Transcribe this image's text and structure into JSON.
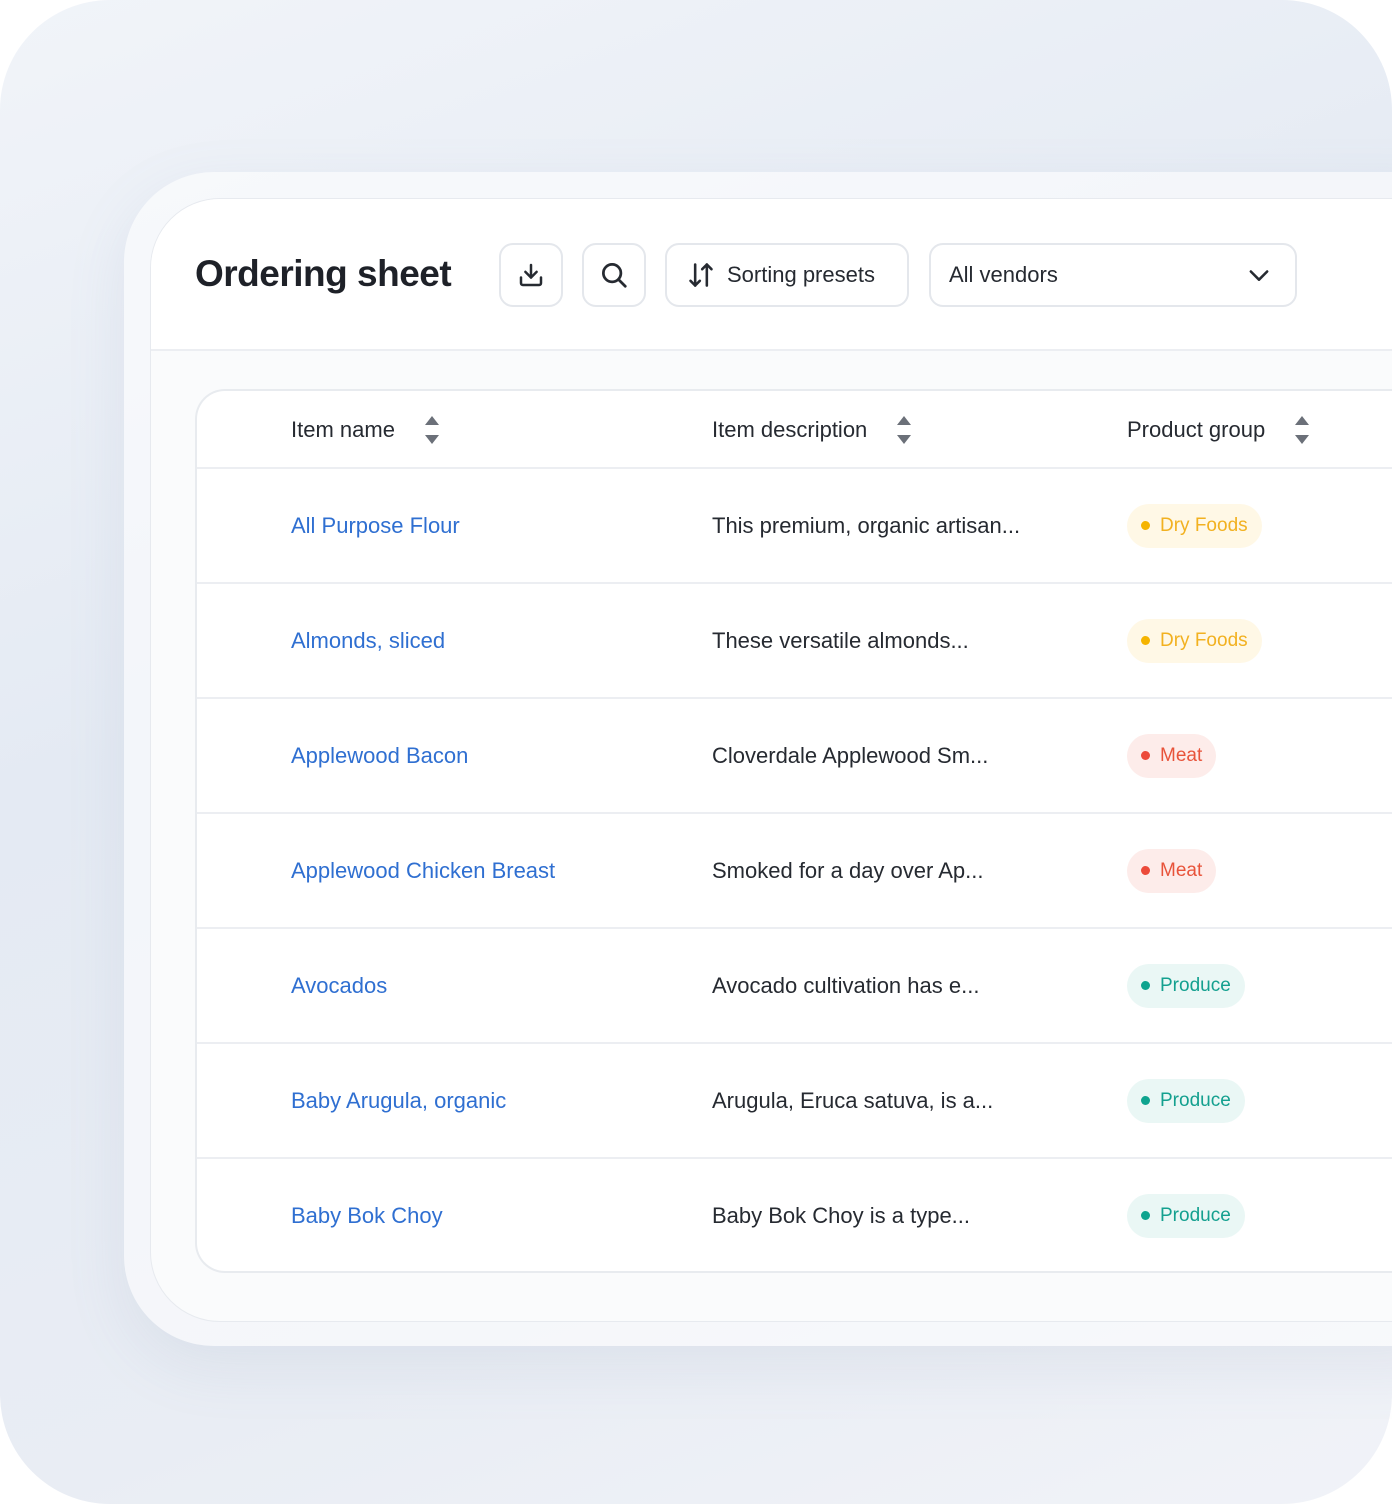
{
  "header": {
    "title": "Ordering sheet",
    "sorting_presets_label": "Sorting presets",
    "vendor_filter": {
      "selected": "All vendors"
    },
    "icons": {
      "download": "download-icon",
      "search": "search-icon",
      "sort": "sort-arrows-icon",
      "chevron": "chevron-down-icon"
    }
  },
  "table": {
    "columns": [
      {
        "label": "Item name"
      },
      {
        "label": "Item description"
      },
      {
        "label": "Product group"
      }
    ],
    "rows": [
      {
        "name": "All Purpose Flour",
        "description": "This premium, organic artisan...",
        "group": "Dry Foods"
      },
      {
        "name": "Almonds, sliced",
        "description": "These versatile almonds...",
        "group": "Dry Foods"
      },
      {
        "name": "Applewood Bacon",
        "description": "Cloverdale Applewood Sm...",
        "group": "Meat"
      },
      {
        "name": "Applewood Chicken Breast",
        "description": "Smoked for a day over Ap...",
        "group": "Meat"
      },
      {
        "name": "Avocados",
        "description": "Avocado cultivation has e...",
        "group": "Produce"
      },
      {
        "name": "Baby Arugula, organic",
        "description": "Arugula, Eruca satuva, is a...",
        "group": "Produce"
      },
      {
        "name": "Baby Bok Choy",
        "description": "Baby Bok Choy is a type...",
        "group": "Produce"
      }
    ]
  },
  "group_colors": {
    "Dry Foods": {
      "text": "#f2b120",
      "dot": "#f5b400",
      "bg": "#fff8e6"
    },
    "Meat": {
      "text": "#e8533a",
      "dot": "#ec4a3a",
      "bg": "#fdecea"
    },
    "Produce": {
      "text": "#14a08f",
      "dot": "#0fa48f",
      "bg": "#eaf7f5"
    }
  },
  "colors": {
    "link": "#2f6fd1",
    "text": "#262a31",
    "border": "#e4e7ec"
  }
}
